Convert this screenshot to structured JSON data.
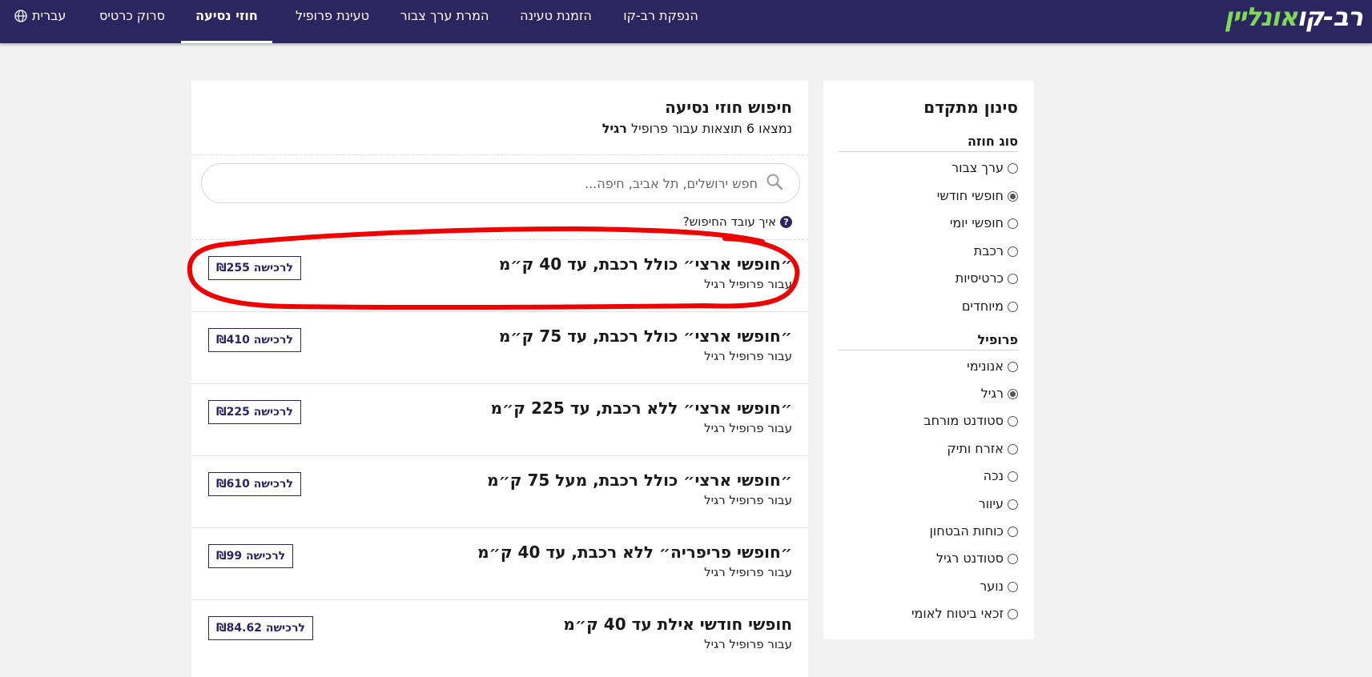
{
  "header": {
    "logo_part1": "רב-קו",
    "logo_part2": "אונליין",
    "nav": [
      {
        "label": "הנפקת רב-קו"
      },
      {
        "label": "הזמנת טעינה"
      },
      {
        "label": "המרת ערך צבור"
      },
      {
        "label": "טעינת פרופיל"
      },
      {
        "label": "חוזי נסיעה",
        "active": true
      },
      {
        "label": "סרוק כרטיס"
      }
    ],
    "language": "עברית"
  },
  "filters": {
    "title": "סינון מתקדם",
    "contract_type": {
      "title": "סוג חוזה",
      "options": [
        {
          "label": "ערך צבור",
          "checked": false
        },
        {
          "label": "חופשי חודשי",
          "checked": true
        },
        {
          "label": "חופשי יומי",
          "checked": false
        },
        {
          "label": "רכבת",
          "checked": false
        },
        {
          "label": "כרטיסיות",
          "checked": false
        },
        {
          "label": "מיוחדים",
          "checked": false
        }
      ]
    },
    "profile": {
      "title": "פרופיל",
      "options": [
        {
          "label": "אנונימי",
          "checked": false
        },
        {
          "label": "רגיל",
          "checked": true
        },
        {
          "label": "סטודנט מורחב",
          "checked": false
        },
        {
          "label": "אזרח ותיק",
          "checked": false
        },
        {
          "label": "נכה",
          "checked": false
        },
        {
          "label": "עיוור",
          "checked": false
        },
        {
          "label": "כוחות הבטחון",
          "checked": false
        },
        {
          "label": "סטודנט רגיל",
          "checked": false
        },
        {
          "label": "נוער",
          "checked": false
        },
        {
          "label": "זכאי ביטוח לאומי",
          "checked": false
        }
      ]
    }
  },
  "results": {
    "title": "חיפוש חוזי נסיעה",
    "subtitle_prefix": "נמצאו 6 תוצאות עבור פרופיל",
    "subtitle_profile": "רגיל",
    "search_placeholder": "חפש ירושלים, תל אביב, חיפה...",
    "help_text": "איך עובד החיפוש?",
    "items": [
      {
        "title": "״חופשי ארצי״ כולל רכבת, עד 40 ק״מ",
        "subtitle": "עבור פרופיל רגיל",
        "button": "לרכישה ₪255"
      },
      {
        "title": "״חופשי ארצי״ כולל רכבת, עד 75 ק״מ",
        "subtitle": "עבור פרופיל רגיל",
        "button": "לרכישה ₪410"
      },
      {
        "title": "״חופשי ארצי״ ללא רכבת, עד 225 ק״מ",
        "subtitle": "עבור פרופיל רגיל",
        "button": "לרכישה ₪225"
      },
      {
        "title": "״חופשי ארצי״ כולל רכבת, מעל 75 ק״מ",
        "subtitle": "עבור פרופיל רגיל",
        "button": "לרכישה ₪610"
      },
      {
        "title": "״חופשי פריפריה״ ללא רכבת, עד 40 ק״מ",
        "subtitle": "עבור פרופיל רגיל",
        "button": "לרכישה ₪99"
      },
      {
        "title": "חופשי חודשי אילת עד 40 ק״מ",
        "subtitle": "עבור פרופיל רגיל",
        "button": "לרכישה ₪84.62"
      }
    ]
  },
  "colors": {
    "header_bg": "#2b2560",
    "logo_accent": "#7ed957",
    "annotation": "#ee0000"
  }
}
